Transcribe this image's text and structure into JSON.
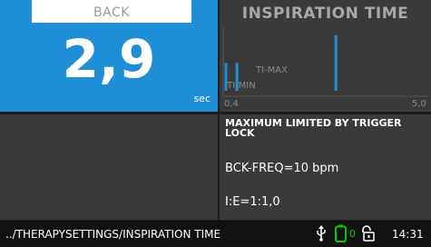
{
  "value_panel": {
    "back_label": "BACK",
    "value": "2,9",
    "unit": "sec",
    "background": "#1e8fd6"
  },
  "graph": {
    "title": "INSPIRATION TIME",
    "ti_max_label": "TI-MAX",
    "ti_min_label": "TI-MIN",
    "axis_min_label": "0,4",
    "axis_max_label": "5,0",
    "axis_min": 0.4,
    "axis_max": 5.0,
    "marker_color": "#1e8fd6",
    "markers": [
      {
        "name": "ti-min-marker",
        "value": 0.4,
        "level": 0.34
      },
      {
        "name": "ti-max-marker",
        "value": 0.65,
        "level": 0.34
      },
      {
        "name": "current-value-marker",
        "value": 2.9,
        "level": 0.68
      }
    ]
  },
  "info": {
    "warning": "MAXIMUM LIMITED BY TRIGGER LOCK",
    "freq": "BCK-FREQ=10 bpm",
    "ie": "I:E=1:1,0"
  },
  "status": {
    "breadcrumb": "../THERAPYSETTINGS/INSPIRATION TIME",
    "battery_level": "0",
    "battery_color": "#00cc00",
    "time": "14:31",
    "icons": [
      "usb-icon",
      "battery-icon",
      "unlocked-icon"
    ]
  }
}
